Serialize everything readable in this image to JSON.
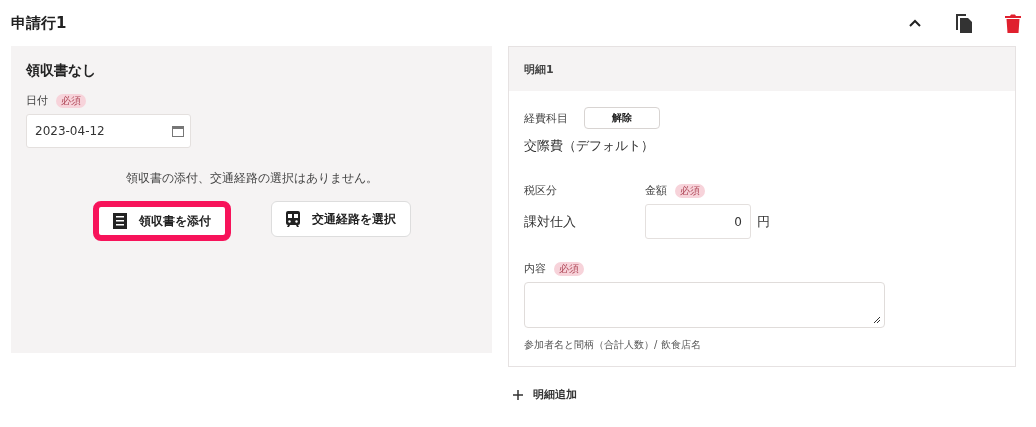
{
  "header": {
    "title": "申請行1",
    "expanded": true
  },
  "receipt_panel": {
    "title": "領収書なし",
    "date_label": "日付",
    "date_required": "必須",
    "date_value": "2023-04-12",
    "message": "領収書の添付、交通経路の選択はありません。",
    "buttons": [
      {
        "kind": "receipt",
        "label": "領収書を添付",
        "highlighted": true
      },
      {
        "kind": "train",
        "label": "交通経路を選択",
        "highlighted": false
      }
    ]
  },
  "detail": {
    "title": "明細1",
    "category_label": "経費科目",
    "clear_button": "解除",
    "category_value": "交際費（デフォルト）",
    "tax_label": "税区分",
    "tax_value": "課対仕入",
    "amount_label": "金額",
    "amount_required": "必須",
    "amount_value": "0",
    "amount_unit": "円",
    "content_label": "内容",
    "content_required": "必須",
    "content_hint": "参加者名と間柄（合計人数）/ 飲食店名"
  },
  "add_detail": "明細追加"
}
